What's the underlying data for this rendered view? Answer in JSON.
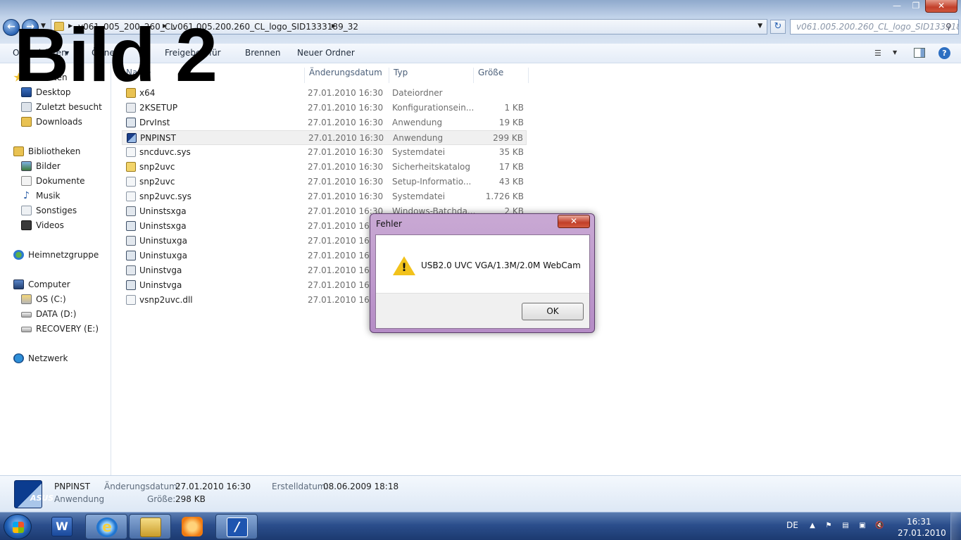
{
  "overlay": {
    "title": "Bild 2"
  },
  "address": {
    "crumbs": [
      "v061_005_200_260_CL",
      "v061.005.200.260_CL_logo_SID1333189_32"
    ],
    "search_placeholder": "v061.005.200.260_CL_logo_SID1333189..."
  },
  "toolbar": {
    "organize": "Organisieren",
    "open": "Öffnen",
    "share": "Freigeben für",
    "burn": "Brennen",
    "new_folder": "Neuer Ordner"
  },
  "nav": {
    "favorites": "Favoriten",
    "desktop": "Desktop",
    "recent": "Zuletzt besucht",
    "downloads": "Downloads",
    "libraries": "Bibliotheken",
    "pictures": "Bilder",
    "documents": "Dokumente",
    "music": "Musik",
    "other": "Sonstiges",
    "videos": "Videos",
    "homegroup": "Heimnetzgruppe",
    "computer": "Computer",
    "drive_c": "OS (C:)",
    "drive_d": "DATA (D:)",
    "drive_e": "RECOVERY (E:)",
    "network": "Netzwerk"
  },
  "columns": {
    "name": "Name",
    "date": "Änderungsdatum",
    "type": "Typ",
    "size": "Größe"
  },
  "files": [
    {
      "name": "x64",
      "date": "27.01.2010 16:30",
      "type": "Dateiordner",
      "size": "",
      "icon": "folder-icon"
    },
    {
      "name": "2KSETUP",
      "date": "27.01.2010 16:30",
      "type": "Konfigurationsein...",
      "size": "1 KB",
      "icon": "config-file-icon"
    },
    {
      "name": "DrvInst",
      "date": "27.01.2010 16:30",
      "type": "Anwendung",
      "size": "19 KB",
      "icon": "application-icon"
    },
    {
      "name": "PNPINST",
      "date": "27.01.2010 16:30",
      "type": "Anwendung",
      "size": "299 KB",
      "icon": "pnpinst-app-icon"
    },
    {
      "name": "sncduvc.sys",
      "date": "27.01.2010 16:30",
      "type": "Systemdatei",
      "size": "35 KB",
      "icon": "system-file-icon"
    },
    {
      "name": "snp2uvc",
      "date": "27.01.2010 16:30",
      "type": "Sicherheitskatalog",
      "size": "17 KB",
      "icon": "security-catalog-icon"
    },
    {
      "name": "snp2uvc",
      "date": "27.01.2010 16:30",
      "type": "Setup-Informatio...",
      "size": "43 KB",
      "icon": "setup-info-icon"
    },
    {
      "name": "snp2uvc.sys",
      "date": "27.01.2010 16:30",
      "type": "Systemdatei",
      "size": "1.726 KB",
      "icon": "system-file-icon"
    },
    {
      "name": "Uninstsxga",
      "date": "27.01.2010 16:30",
      "type": "Windows-Batchda...",
      "size": "2 KB",
      "icon": "batch-file-icon"
    },
    {
      "name": "Uninstsxga",
      "date": "27.01.2010 16:30",
      "type": "",
      "size": "",
      "icon": "application-icon"
    },
    {
      "name": "Uninstuxga",
      "date": "27.01.2010 16:30",
      "type": "",
      "size": "",
      "icon": "batch-file-icon"
    },
    {
      "name": "Uninstuxga",
      "date": "27.01.2010 16:30",
      "type": "",
      "size": "",
      "icon": "application-icon"
    },
    {
      "name": "Uninstvga",
      "date": "27.01.2010 16:30",
      "type": "",
      "size": "",
      "icon": "batch-file-icon"
    },
    {
      "name": "Uninstvga",
      "date": "27.01.2010 16:30",
      "type": "",
      "size": "",
      "icon": "application-icon"
    },
    {
      "name": "vsnp2uvc.dll",
      "date": "27.01.2010 16:30",
      "type": "",
      "size": "",
      "icon": "dll-file-icon"
    }
  ],
  "dialog": {
    "title": "Fehler",
    "message": "USB2.0 UVC VGA/1.3M/2.0M WebCam",
    "ok": "OK"
  },
  "details": {
    "name": "PNPINST",
    "kind": "Anwendung",
    "modified_label": "Änderungsdatum:",
    "modified_value": "27.01.2010 16:30",
    "size_label": "Größe:",
    "size_value": "298 KB",
    "created_label": "Erstelldatum:",
    "created_value": "08.06.2009 18:18",
    "icon_text": "ASUS"
  },
  "taskbar": {
    "lang": "DE",
    "time": "16:31",
    "date": "27.01.2010"
  },
  "colors": {
    "taskbar": "#2b4e8c",
    "dialog_frame": "#b58cc6",
    "selection": "#f0f0f0"
  }
}
